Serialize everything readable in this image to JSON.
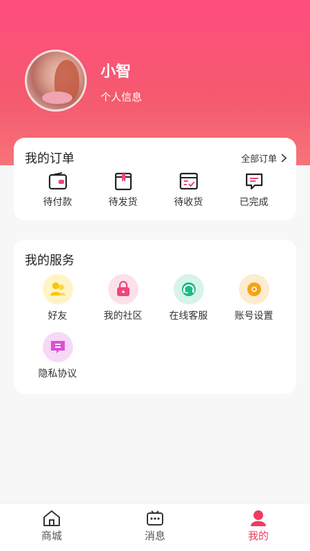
{
  "profile": {
    "name": "小智",
    "info_link": "个人信息"
  },
  "orders": {
    "title": "我的订单",
    "all_label": "全部订单",
    "items": [
      {
        "label": "待付款",
        "icon": "wallet-icon"
      },
      {
        "label": "待发货",
        "icon": "package-icon"
      },
      {
        "label": "待收货",
        "icon": "delivery-icon"
      },
      {
        "label": "已完成",
        "icon": "message-check-icon"
      }
    ]
  },
  "services": {
    "title": "我的服务",
    "items": [
      {
        "label": "好友",
        "icon": "friends-icon",
        "bg": "#fff4c4",
        "color": "#f5c60b"
      },
      {
        "label": "我的社区",
        "icon": "community-icon",
        "bg": "#fde1ea",
        "color": "#f0457a"
      },
      {
        "label": "在线客服",
        "icon": "support-icon",
        "bg": "#d7f4ea",
        "color": "#1fb889"
      },
      {
        "label": "账号设置",
        "icon": "settings-icon",
        "bg": "#fdecd0",
        "color": "#f5a418"
      },
      {
        "label": "隐私协议",
        "icon": "privacy-icon",
        "bg": "#f6d9f6",
        "color": "#de4fd6"
      }
    ]
  },
  "tabbar": {
    "items": [
      {
        "label": "商城",
        "icon": "home-icon",
        "active": false
      },
      {
        "label": "消息",
        "icon": "message-icon",
        "active": false
      },
      {
        "label": "我的",
        "icon": "user-icon",
        "active": true
      }
    ]
  },
  "colors": {
    "header_top": "#ff4d7e",
    "header_bottom": "#f6737a",
    "accent": "#f03c5e"
  }
}
